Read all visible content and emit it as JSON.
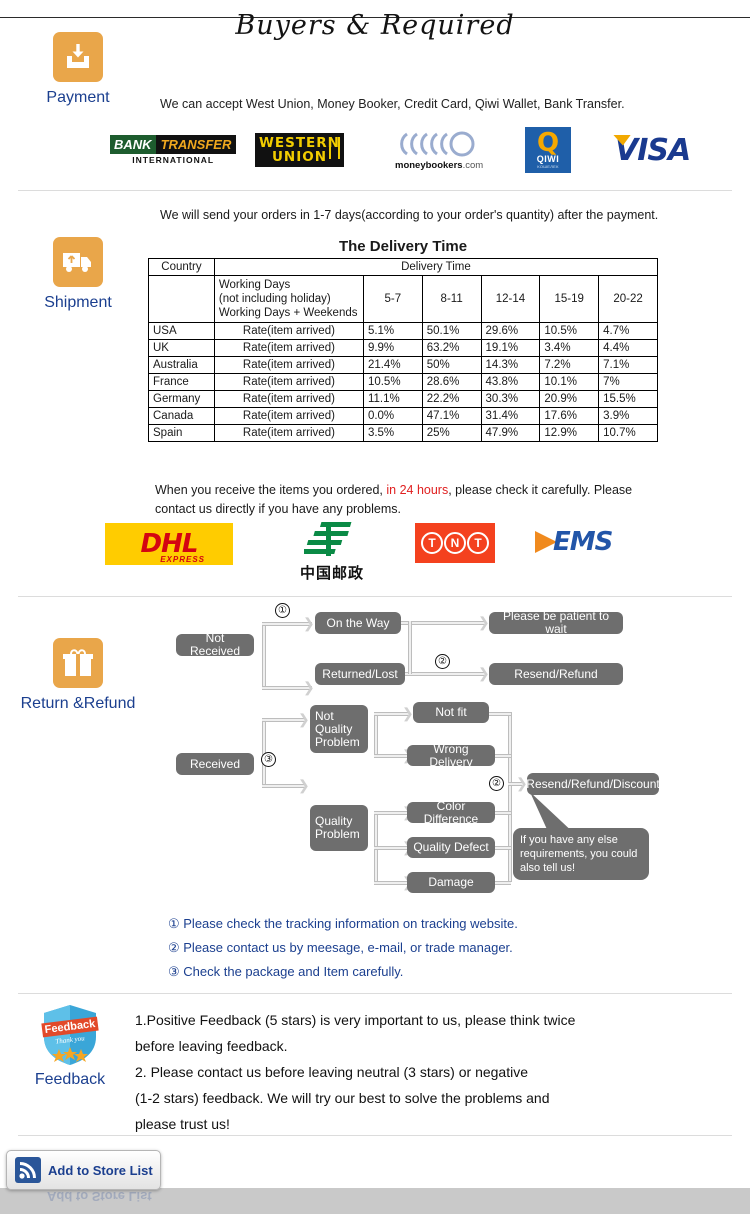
{
  "header": {
    "title": "Buyers & Required"
  },
  "payment": {
    "icon": "inbox-download-icon",
    "label": "Payment",
    "description": "We can accept West Union, Money Booker, Credit Card, Qiwi Wallet, Bank Transfer.",
    "logos": [
      {
        "name": "bank-transfer-logo",
        "line1": "BANK",
        "line2": "TRANSFER",
        "line3": "INTERNATIONAL"
      },
      {
        "name": "western-union-logo",
        "line1": "WESTERN",
        "line2": "UNION"
      },
      {
        "name": "moneybookers-logo",
        "line1": "moneybookers",
        "line2": ".com"
      },
      {
        "name": "qiwi-logo",
        "line1": "Q",
        "line2": "QIWI",
        "line3": "КОШЕЛЕК"
      },
      {
        "name": "visa-logo",
        "line1": "VISA"
      }
    ]
  },
  "shipment": {
    "icon": "delivery-truck-icon",
    "label": "Shipment",
    "description": "We will send your orders in 1-7 days(according to your order's quantity) after the payment.",
    "table_title": "The Delivery Time",
    "table": {
      "col_country": "Country",
      "col_delivery_time": "Delivery Time",
      "working_days_lines": [
        "Working Days",
        "(not including holiday)",
        "Working Days + Weekends"
      ],
      "day_ranges": [
        "5-7",
        "8-11",
        "12-14",
        "15-19",
        "20-22"
      ],
      "rate_label": "Rate(item arrived)",
      "rows": [
        {
          "country": "USA",
          "rate": "Rate(item arrived)",
          "values": [
            "5.1%",
            "50.1%",
            "29.6%",
            "10.5%",
            "4.7%"
          ]
        },
        {
          "country": "UK",
          "rate": "Rate(item arrived)",
          "values": [
            "9.9%",
            "63.2%",
            "19.1%",
            "3.4%",
            "4.4%"
          ]
        },
        {
          "country": "Australia",
          "rate": "Rate(item arrived)",
          "values": [
            "21.4%",
            "50%",
            "14.3%",
            "7.2%",
            "7.1%"
          ]
        },
        {
          "country": "France",
          "rate": "Rate(item arrived)",
          "values": [
            "10.5%",
            "28.6%",
            "43.8%",
            "10.1%",
            "7%"
          ]
        },
        {
          "country": "Germany",
          "rate": "Rate(item arrived)",
          "values": [
            "11.1%",
            "22.2%",
            "30.3%",
            "20.9%",
            "15.5%"
          ]
        },
        {
          "country": "Canada",
          "rate": "Rate(item arrived)",
          "values": [
            "0.0%",
            "47.1%",
            "31.4%",
            "17.6%",
            "3.9%"
          ]
        },
        {
          "country": "Spain",
          "rate": "Rate(item arrived)",
          "values": [
            "3.5%",
            "25%",
            "47.9%",
            "12.9%",
            "10.7%"
          ]
        }
      ]
    },
    "note_part1": "When you receive the items you ordered, ",
    "note_highlight": "in 24 hours",
    "note_part2": ", please check it carefully. Please",
    "note_line2": "contact us directly if you have any problems.",
    "highlight_color": "#e02020",
    "carriers": [
      {
        "name": "dhl-logo",
        "text": "DHL",
        "sub": "EXPRESS"
      },
      {
        "name": "china-post-logo",
        "text": "中国邮政"
      },
      {
        "name": "tnt-logo",
        "letters": [
          "T",
          "N",
          "T"
        ]
      },
      {
        "name": "ems-logo",
        "text": "EMS"
      }
    ]
  },
  "return_refund": {
    "icon": "gift-box-icon",
    "label": "Return &Refund",
    "flow": {
      "not_received": "Not Received",
      "on_the_way": "On the Way",
      "returned_lost": "Returned/Lost",
      "please_wait": "Please be patient to wait",
      "resend_refund": "Resend/Refund",
      "received": "Received",
      "not_quality_problem": "Not Quality Problem",
      "quality_problem": "Quality Problem",
      "not_fit": "Not fit",
      "wrong_delivery": "Wrong Delivery",
      "color_difference": "Color Difference",
      "quality_defect": "Quality Defect",
      "damage": "Damage",
      "resend_refund_discount": "Resend/Refund/Discount",
      "bubble": "If you have any else requirements, you could also tell us!",
      "marker1": "①",
      "marker2": "②",
      "marker2b": "②",
      "marker2c": "②",
      "marker3": "③"
    },
    "notes": [
      "① Please check the tracking information on tracking website.",
      "② Please contact us by meesage, e-mail, or trade manager.",
      "③ Check the package and Item carefully."
    ],
    "notes_color": "#1b3f8f"
  },
  "feedback": {
    "icon": "feedback-badge-icon",
    "badge_text": "Feedback",
    "badge_sub": "Thank you",
    "label": "Feedback",
    "lines": [
      "1.Positive Feedback (5 stars) is very important to us, please think twice",
      " before leaving feedback.",
      "2. Please contact us before leaving neutral (3 stars) or negative",
      "(1-2 stars) feedback. We will try our best to solve the problems and",
      " please trust us!"
    ]
  },
  "footer": {
    "store_button_label": "Add to Store List",
    "store_button_icon": "rss-icon"
  }
}
